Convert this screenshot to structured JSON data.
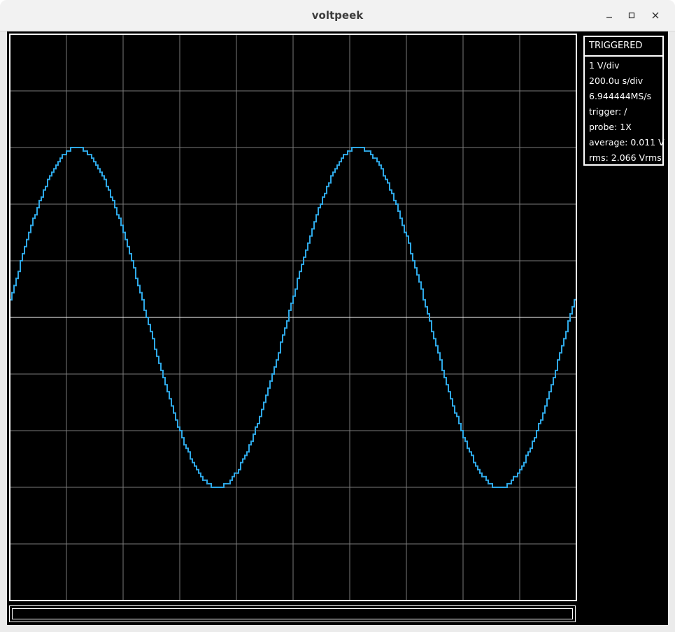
{
  "window": {
    "title": "voltpeek"
  },
  "window_controls": [
    "minimize",
    "maximize",
    "close"
  ],
  "status": {
    "state": "TRIGGERED"
  },
  "readouts": {
    "vdiv": "1 V/div",
    "tdiv": "200.0u s/div",
    "sample_rate": "6.944444MS/s",
    "trigger": "trigger: /",
    "probe": "probe: 1X",
    "average": "average: 0.011 V",
    "rms": "rms: 2.066 Vrms"
  },
  "command_input": {
    "value": ""
  },
  "colors": {
    "trace": "#2ea8e6",
    "grid": "#7a7a7a",
    "center_axis": "#ffffff",
    "background": "#000000"
  },
  "chart_data": {
    "type": "line",
    "title": "",
    "xlabel": "",
    "ylabel": "",
    "x_unit": "s",
    "y_unit": "V",
    "x_divisions": 10,
    "y_divisions": 10,
    "volts_per_div": 1,
    "seconds_per_div": 0.0002,
    "xlim": [
      0,
      0.002
    ],
    "ylim": [
      -5,
      5
    ],
    "grid": true,
    "series": [
      {
        "waveform": "sine",
        "amplitude_v": 3.0,
        "offset_v": 0.0,
        "period_s": 0.000995,
        "phase_deg": 5.5,
        "quantization_v": 0.0625
      }
    ]
  }
}
